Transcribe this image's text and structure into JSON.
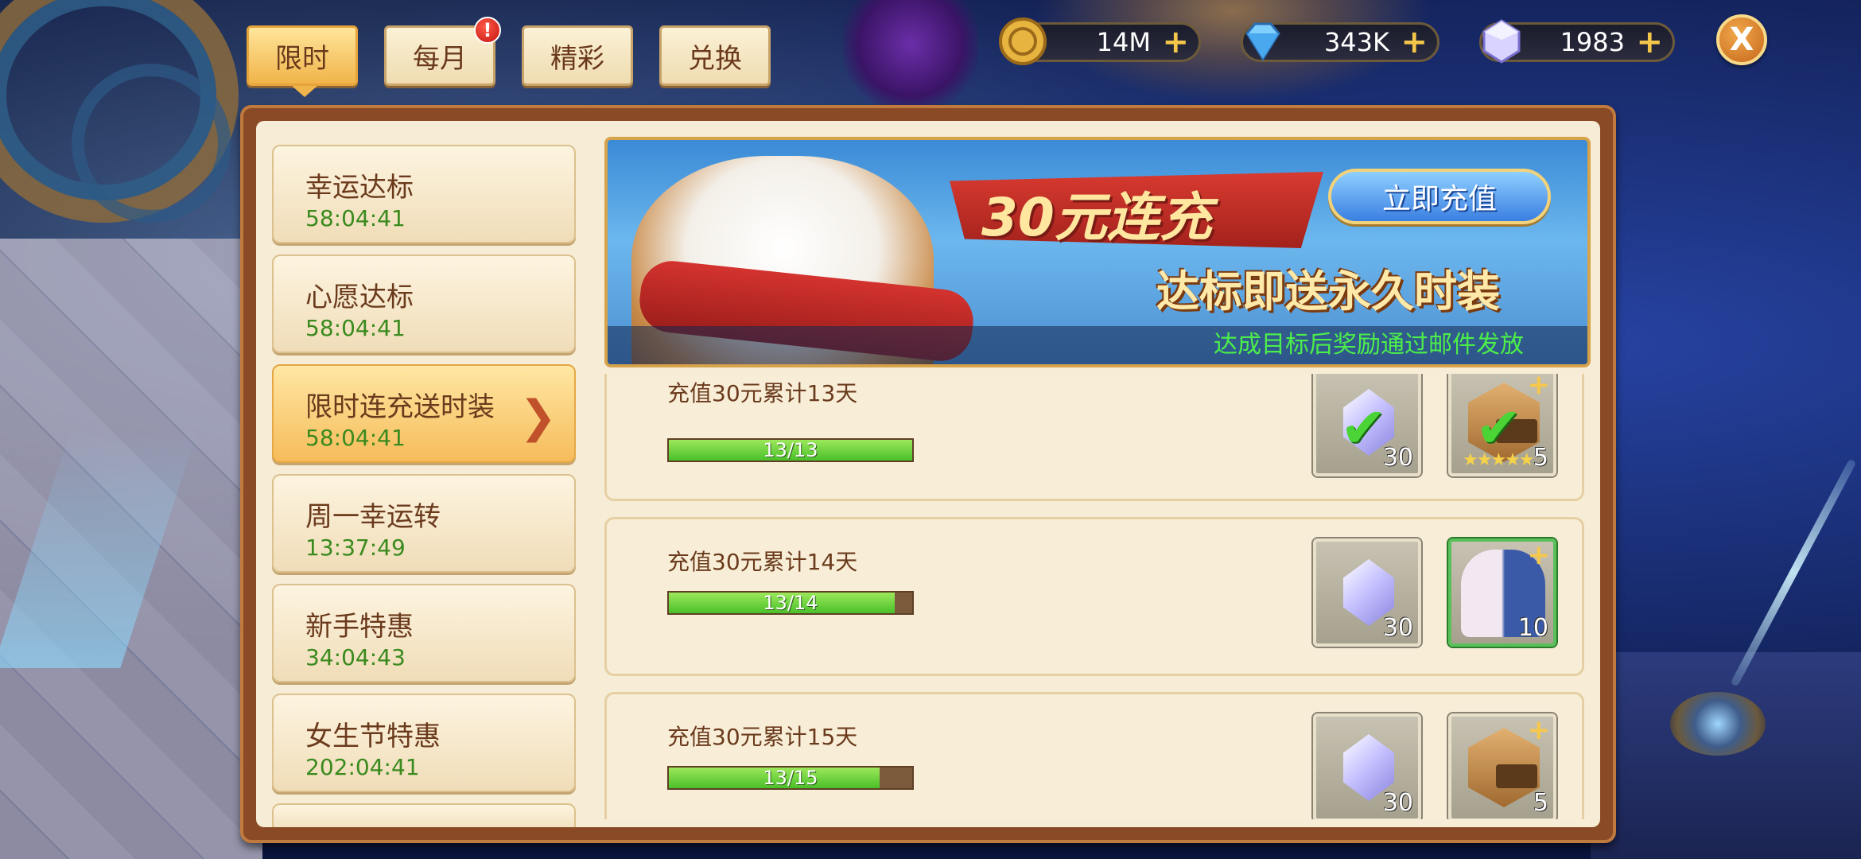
{
  "tabs": [
    {
      "label": "限时",
      "active": true
    },
    {
      "label": "每月",
      "badge": "!"
    },
    {
      "label": "精彩"
    },
    {
      "label": "兑换"
    }
  ],
  "currency": [
    {
      "icon": "gold-coin-icon",
      "value": "14M",
      "plus": "+"
    },
    {
      "icon": "diamond-icon",
      "value": "343K",
      "plus": "+"
    },
    {
      "icon": "crystal-icon",
      "value": "1983",
      "plus": "+"
    }
  ],
  "close_label": "X",
  "sidebar": {
    "items": [
      {
        "title": "幸运达标",
        "time": "58:04:41"
      },
      {
        "title": "心愿达标",
        "time": "58:04:41"
      },
      {
        "title": "限时连充送时装",
        "time": "58:04:41",
        "active": true,
        "arrow": "❯"
      },
      {
        "title": "周一幸运转",
        "time": "13:37:49"
      },
      {
        "title": "新手特惠",
        "time": "34:04:43"
      },
      {
        "title": "女生节特惠",
        "time": "202:04:41"
      }
    ]
  },
  "banner": {
    "title": "30元连充",
    "subtitle": "达标即送永久时装",
    "button": "立即充值",
    "note": "达成目标后奖励通过邮件发放"
  },
  "rewards": [
    {
      "title": "充值30元累计13天",
      "progress_text": "13/13",
      "progress": 1.0,
      "items": [
        {
          "icon": "crystal-icon",
          "count": "30",
          "claimed": true
        },
        {
          "icon": "helmet-icon",
          "count": "5",
          "claimed": true,
          "stars": "★★★★★"
        }
      ]
    },
    {
      "title": "充值30元累计14天",
      "progress_text": "13/14",
      "progress": 0.9286,
      "items": [
        {
          "icon": "crystal-icon",
          "count": "30"
        },
        {
          "icon": "outfit-icon",
          "count": "10",
          "highlight": true
        }
      ]
    },
    {
      "title": "充值30元累计15天",
      "progress_text": "13/15",
      "progress": 0.8667,
      "items": [
        {
          "icon": "crystal-icon",
          "count": "30"
        },
        {
          "icon": "helmet-icon",
          "count": "5"
        }
      ]
    }
  ],
  "colors": {
    "progress_fill": "#4ac02a",
    "timer_text": "#3a8a1e",
    "banner_note": "#4cee4a"
  }
}
